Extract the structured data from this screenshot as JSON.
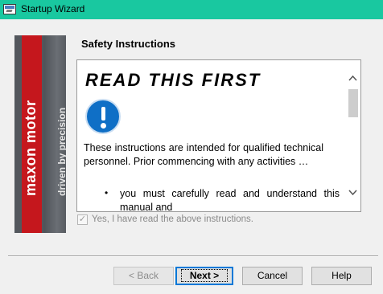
{
  "window": {
    "title": "Startup Wizard",
    "icon": "wizard-app-icon",
    "title_bar_color": "#19c8a0"
  },
  "banner": {
    "brand": "maxon motor",
    "slogan": "driven by precision",
    "brand_color": "#c5171d"
  },
  "page": {
    "section_title": "Safety Instructions"
  },
  "document": {
    "heading": "READ THIS FIRST",
    "icon": "info-icon",
    "icon_color": "#0f6fc6",
    "paragraph": "These instructions are intended for qualified technical personnel. Prior commencing with any activities …",
    "bullet_symbol": "•",
    "bullet_text": "you must carefully read and understand this manual and"
  },
  "scrollbar": {
    "up_arrow": "^",
    "down_arrow": "v"
  },
  "agreement": {
    "checked": true,
    "check_mark": "✓",
    "label": "Yes, I have read the above instructions.",
    "enabled": false
  },
  "buttons": {
    "back": "< Back",
    "next": "Next >",
    "cancel": "Cancel",
    "help": "Help"
  }
}
